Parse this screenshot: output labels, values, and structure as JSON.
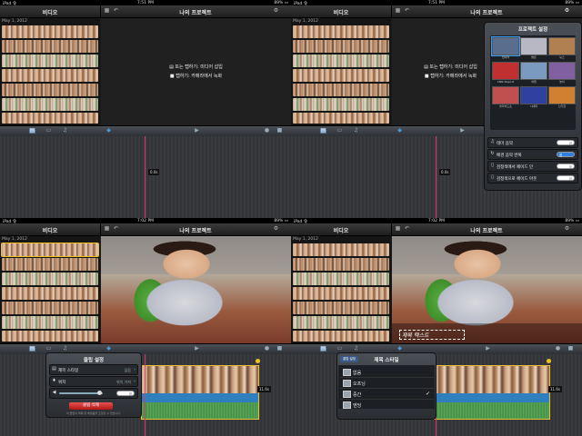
{
  "status": {
    "device": "iPad",
    "signal": "令",
    "times": [
      "7:51 PM",
      "7:51 PM",
      "7:02 PM",
      "7:02 PM"
    ],
    "battery": "89% ▭"
  },
  "nav": {
    "media_title": "비디오",
    "project_title": "나의 프로젝트"
  },
  "library": {
    "date": "May 1, 2012"
  },
  "viewer_hints": {
    "insert": "또는 탭하기: 미디어 삽입",
    "record": "탭하기: 카메라에서 녹화"
  },
  "timeline": {
    "playhead_time": "0.0s",
    "clip_duration": "11.6s"
  },
  "overlay_title": "제목 텍스트",
  "project_settings": {
    "title": "프로젝트 설정",
    "themes": [
      {
        "label": "현대적",
        "color": "#5a6d8c"
      },
      {
        "label": "밝은",
        "color": "#b8b8c4"
      },
      {
        "label": "뉴스",
        "color": "#b08050"
      },
      {
        "label": "CNN iReport",
        "color": "#c03030"
      },
      {
        "label": "여행",
        "color": "#7a9ac0"
      },
      {
        "label": "놀이",
        "color": "#8060a0"
      },
      {
        "label": "슬라이드쇼",
        "color": "#c05050"
      },
      {
        "label": "시네마",
        "color": "#3040a0"
      },
      {
        "label": "신기한",
        "color": "#d08030"
      }
    ],
    "rows": [
      {
        "label": "테마 음악",
        "toggle": "끔",
        "on": false
      },
      {
        "label": "배경 음악 반복",
        "toggle": "켬",
        "on": true
      },
      {
        "label": "검정색에서 페이드 인",
        "toggle": "끔",
        "on": false
      },
      {
        "label": "검정색으로 페이드 아웃",
        "toggle": "끔",
        "on": false
      }
    ]
  },
  "clip_settings": {
    "title": "클립 설정",
    "title_style": {
      "label": "제목 스타일",
      "value": "없음"
    },
    "location": {
      "label": "위치",
      "value": "위치 가져"
    },
    "volume_toggle": "켬",
    "delete": "클립 삭제",
    "footnote": "이 클립의 제목 및 배경음을 조정할 수 있습니다."
  },
  "title_style": {
    "back": "클립 설정",
    "title": "제목 스타일",
    "options": [
      {
        "label": "없음",
        "checked": false
      },
      {
        "label": "오프닝",
        "checked": false
      },
      {
        "label": "중간",
        "checked": true
      },
      {
        "label": "엔딩",
        "checked": false
      }
    ],
    "checkmark": "✓"
  }
}
